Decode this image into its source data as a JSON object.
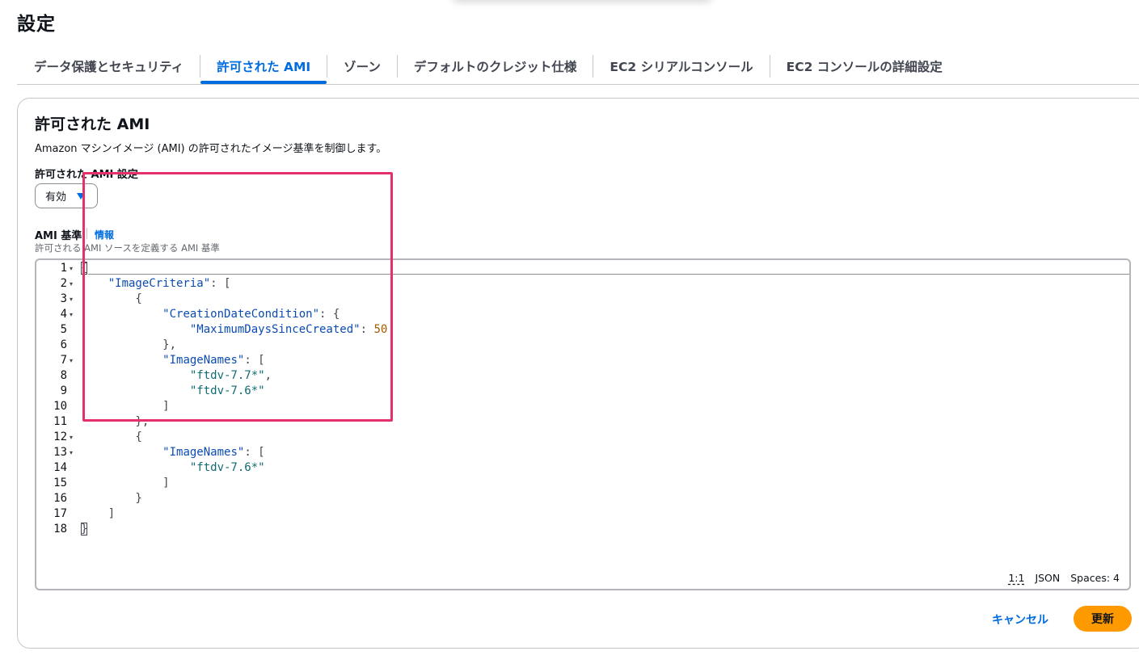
{
  "page": {
    "title": "設定"
  },
  "tabs": [
    {
      "label": "データ保護とセキュリティ"
    },
    {
      "label": "許可された AMI"
    },
    {
      "label": "ゾーン"
    },
    {
      "label": "デフォルトのクレジット仕様"
    },
    {
      "label": "EC2 シリアルコンソール"
    },
    {
      "label": "EC2 コンソールの詳細設定"
    }
  ],
  "active_tab": "許可された AMI",
  "panel": {
    "title": "許可された AMI",
    "description": "Amazon マシンイメージ (AMI) の許可されたイメージ基準を制御します。",
    "setting_label": "許可された AMI 設定",
    "setting_value": "有効",
    "criteria_label": "AMI 基準",
    "info_link": "情報",
    "criteria_description": "許可される AMI ソースを定義する AMI 基準"
  },
  "editor": {
    "line_numbers": [
      "1",
      "2",
      "3",
      "4",
      "5",
      "6",
      "7",
      "8",
      "9",
      "10",
      "11",
      "12",
      "13",
      "14",
      "15",
      "16",
      "17",
      "18"
    ],
    "lines": [
      "{",
      "    \"ImageCriteria\": [",
      "        {",
      "            \"CreationDateCondition\": {",
      "                \"MaximumDaysSinceCreated\": 50",
      "            },",
      "            \"ImageNames\": [",
      "                \"ftdv-7.7*\",",
      "                \"ftdv-7.6*\"",
      "            ]",
      "        },",
      "        {",
      "            \"ImageNames\": [",
      "                \"ftdv-7.6*\"",
      "            ]",
      "        }",
      "    ]",
      "}"
    ],
    "status": {
      "position": "1:1",
      "language": "JSON",
      "spaces": "Spaces: 4"
    }
  },
  "actions": {
    "cancel": "キャンセル",
    "update": "更新"
  },
  "colors": {
    "accent": "#006ce0",
    "primary_button": "#ff9900",
    "highlight_box": "#e4306b"
  }
}
